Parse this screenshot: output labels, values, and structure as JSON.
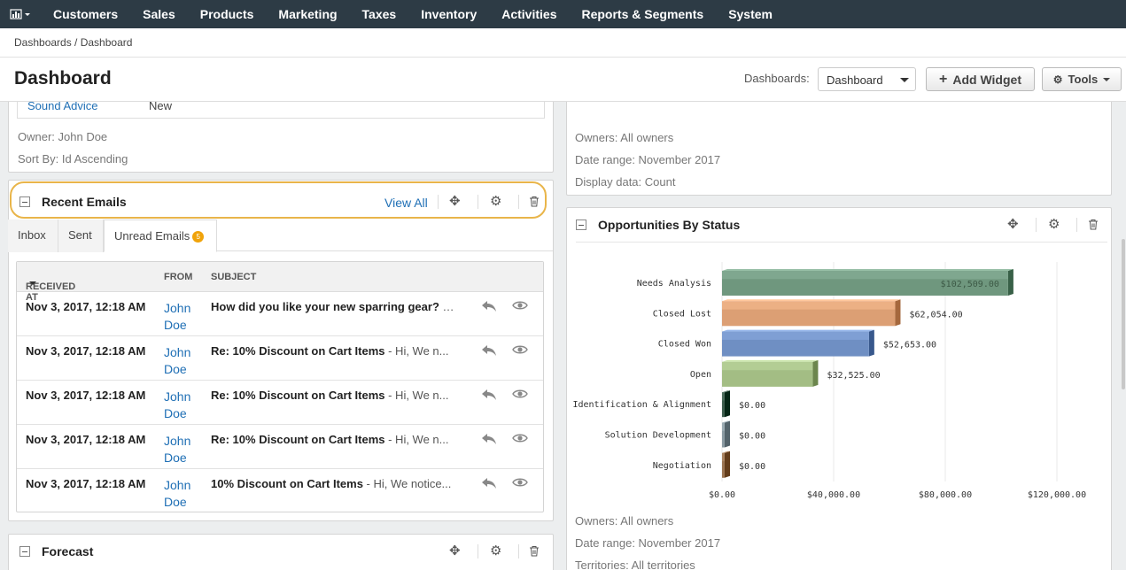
{
  "nav": {
    "logo_icon": "bar-chart-icon",
    "items": [
      "Customers",
      "Sales",
      "Products",
      "Marketing",
      "Taxes",
      "Inventory",
      "Activities",
      "Reports & Segments",
      "System"
    ]
  },
  "breadcrumb": {
    "text": "Dashboards / Dashboard"
  },
  "header": {
    "title": "Dashboard",
    "dashboards_label": "Dashboards:",
    "dashboards_value": "Dashboard",
    "add_widget": "Add Widget",
    "tools": "Tools"
  },
  "left_top": {
    "row_link": "Sound Advice",
    "row_status": "New",
    "owner": "Owner: John Doe",
    "sort": "Sort By: Id Ascending"
  },
  "recent_emails": {
    "title": "Recent Emails",
    "view_all": "View All",
    "tabs": [
      "Inbox",
      "Sent",
      "Unread Emails"
    ],
    "unread_count": "5",
    "columns": {
      "received": "RECEIVED AT",
      "from": "FROM",
      "subject": "SUBJECT"
    },
    "rows": [
      {
        "date": "Nov 3, 2017, 12:18 AM",
        "from_first": "John",
        "from_last": "Doe",
        "subject": "How did you like your new sparring gear?",
        "preview": " - Hi, ..."
      },
      {
        "date": "Nov 3, 2017, 12:18 AM",
        "from_first": "John",
        "from_last": "Doe",
        "subject": "Re: 10% Discount on Cart Items",
        "preview": " - Hi, We n..."
      },
      {
        "date": "Nov 3, 2017, 12:18 AM",
        "from_first": "John",
        "from_last": "Doe",
        "subject": "Re: 10% Discount on Cart Items",
        "preview": " - Hi, We n..."
      },
      {
        "date": "Nov 3, 2017, 12:18 AM",
        "from_first": "John",
        "from_last": "Doe",
        "subject": "Re: 10% Discount on Cart Items",
        "preview": " - Hi, We n..."
      },
      {
        "date": "Nov 3, 2017, 12:18 AM",
        "from_first": "John",
        "from_last": "Doe",
        "subject": "10% Discount on Cart Items",
        "preview": " - Hi, We notice..."
      }
    ]
  },
  "forecast": {
    "title": "Forecast"
  },
  "right_top": {
    "owners": "Owners: All owners",
    "date_range": "Date range: November 2017",
    "display": "Display data: Count"
  },
  "opportunities": {
    "title": "Opportunities By Status",
    "owners": "Owners: All owners",
    "date_range": "Date range: November 2017",
    "territories": "Territories: All territories"
  },
  "chart_data": {
    "type": "bar",
    "orientation": "horizontal",
    "title": "",
    "categories": [
      "Needs Analysis",
      "Closed Lost",
      "Closed Won",
      "Open",
      "Identification & Alignment",
      "Solution Development",
      "Negotiation"
    ],
    "values": [
      102509,
      62054,
      52653,
      32525,
      0,
      0,
      0
    ],
    "value_labels": [
      "$102,509.00",
      "$62,054.00",
      "$52,653.00",
      "$32,525.00",
      "$0.00",
      "$0.00",
      "$0.00"
    ],
    "x_ticks": [
      "$0.00",
      "$40,000.00",
      "$80,000.00",
      "$120,000.00"
    ],
    "xlim": [
      0,
      120000
    ],
    "colors": [
      "#6f977e",
      "#dc9f74",
      "#6f8fc3",
      "#a3bd84",
      "#3c5c4c",
      "#8a9aa2",
      "#9a7452"
    ],
    "grid": true
  }
}
